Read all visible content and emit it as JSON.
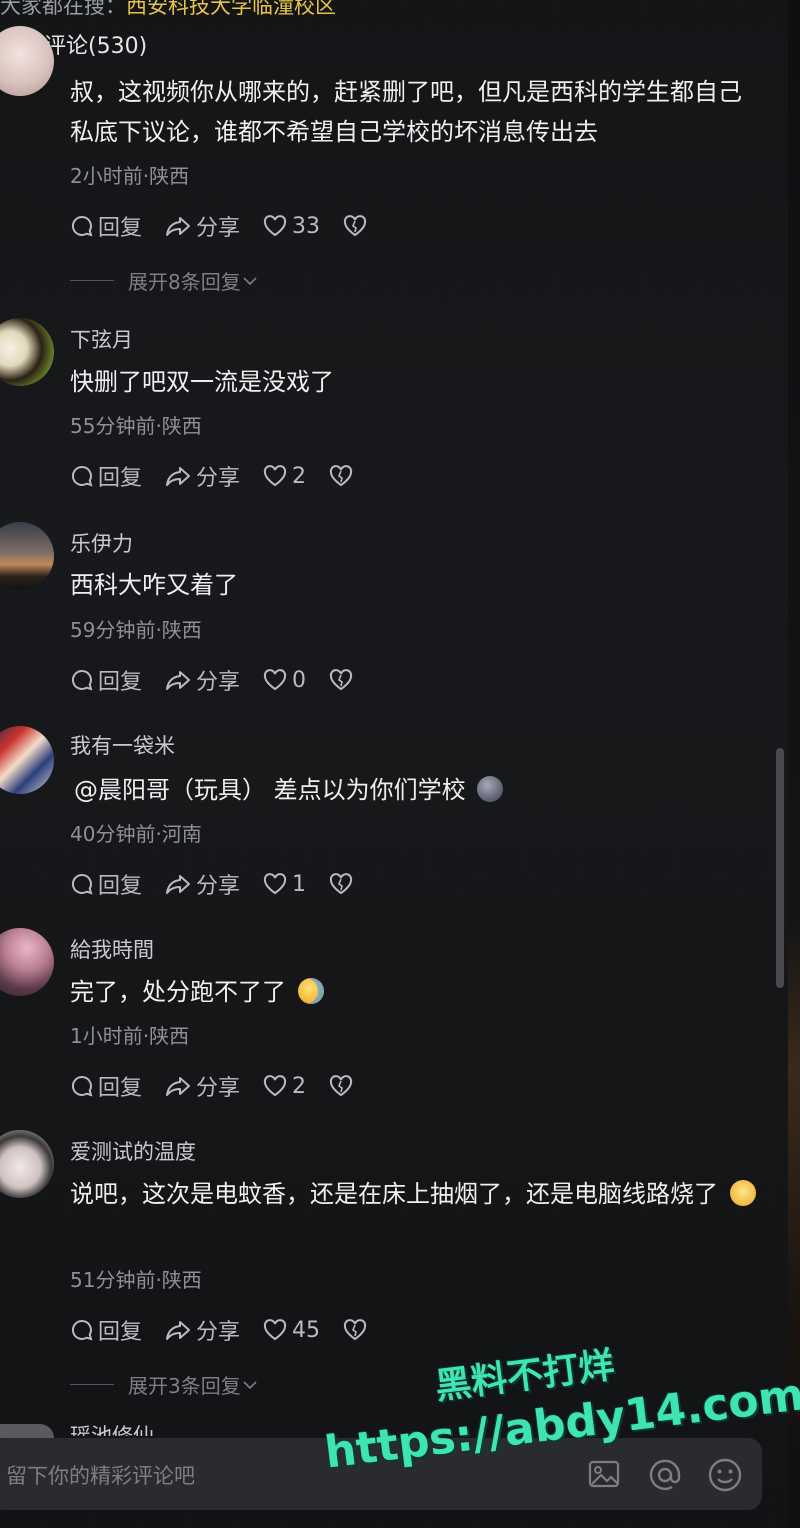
{
  "header": {
    "hint_prefix": "大家都在搜：",
    "hint_link": "西安科技大学临潼校区",
    "comment_count_label": "全部评论(530)"
  },
  "action_labels": {
    "reply": "回复",
    "share": "分享"
  },
  "comments": [
    {
      "username": "",
      "text": "叔，这视频你从哪来的，赶紧删了吧，但凡是西科的学生都自己私底下议论，谁都不希望自己学校的坏消息传出去",
      "meta": "2小时前·陕西",
      "likes": "33",
      "expand": "展开8条回复"
    },
    {
      "username": "下弦月",
      "text": "快删了吧双一流是没戏了",
      "meta": "55分钟前·陕西",
      "likes": "2"
    },
    {
      "username": "乐伊力",
      "text": "西科大咋又着了",
      "meta": "59分钟前·陕西",
      "likes": "0"
    },
    {
      "username": "我有一袋米",
      "text": "@晨阳哥（玩具） 差点以为你们学校",
      "meta": "40分钟前·河南",
      "likes": "1"
    },
    {
      "username": "給我時間",
      "text": "完了，处分跑不了了",
      "meta": "1小时前·陕西",
      "likes": "2"
    },
    {
      "username": "爱测试的温度",
      "text": "说吧，这次是电蚊香，还是在床上抽烟了，还是电脑线路烧了",
      "meta": "51分钟前·陕西",
      "likes": "45",
      "expand": "展开3条回复"
    },
    {
      "username": "瑶池修仙"
    }
  ],
  "input": {
    "placeholder": "留下你的精彩评论吧"
  },
  "watermark": {
    "line1": "黑料不打烊",
    "line2": "https://abdy14.com"
  },
  "icons": {
    "comment": "comment-bubble-icon",
    "share": "share-arrow-icon",
    "like": "heart-icon",
    "dislike": "broken-heart-icon",
    "image": "image-icon",
    "mention": "at-icon",
    "emoji": "smiley-icon"
  }
}
